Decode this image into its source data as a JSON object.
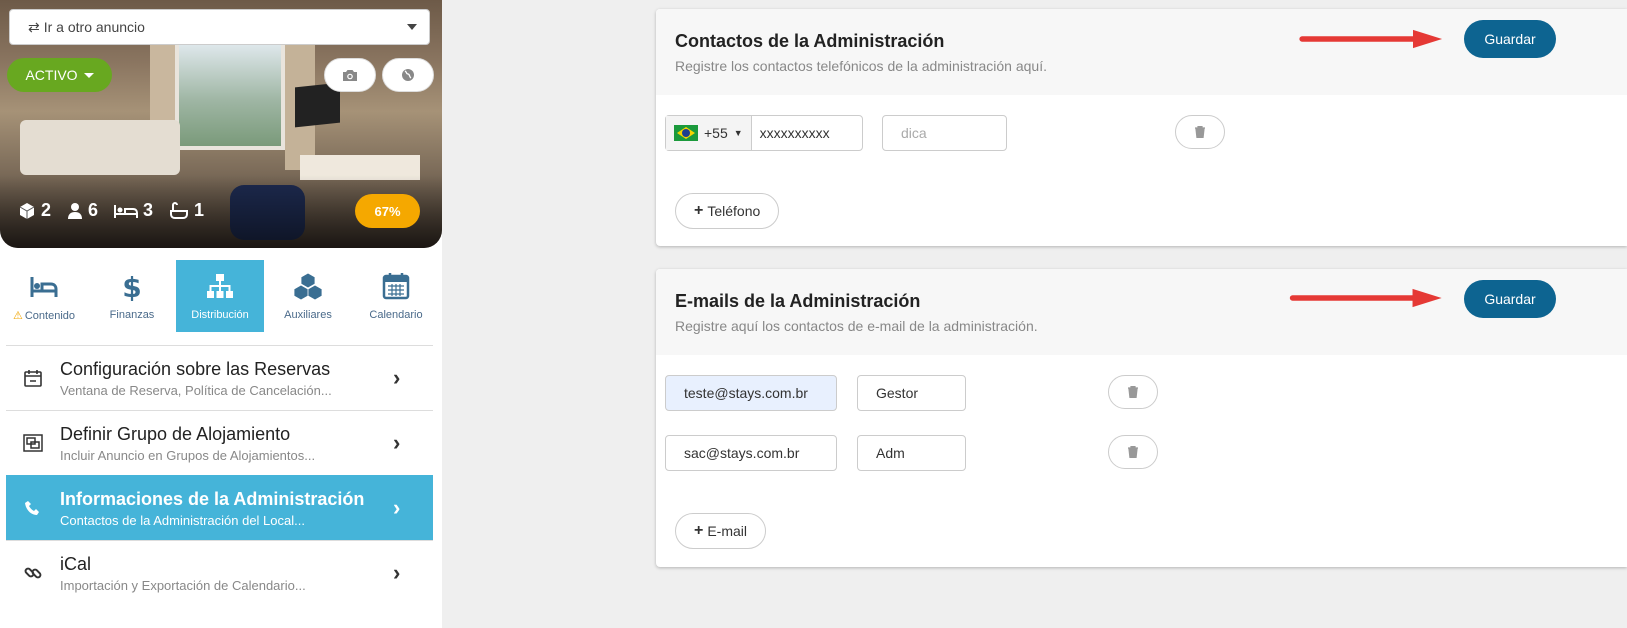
{
  "sidebar": {
    "listing_select": "Ir a otro anuncio",
    "status": "ACTIVO",
    "stats": {
      "rooms": "2",
      "guests": "6",
      "beds": "3",
      "baths": "1"
    },
    "completion": "67%",
    "tabs": [
      {
        "label": "Contenido"
      },
      {
        "label": "Finanzas"
      },
      {
        "label": "Distribución"
      },
      {
        "label": "Auxiliares"
      },
      {
        "label": "Calendario"
      }
    ],
    "menu": [
      {
        "title": "Configuración sobre las Reservas",
        "subtitle": "Ventana de Reserva, Política de Cancelación..."
      },
      {
        "title": "Definir Grupo de Alojamiento",
        "subtitle": "Incluir Anuncio en Grupos de Alojamientos..."
      },
      {
        "title": "Informaciones de la Administración",
        "subtitle": "Contactos de la Administración del Local..."
      },
      {
        "title": "iCal",
        "subtitle": "Importación y Exportación de Calendario..."
      }
    ]
  },
  "phones": {
    "title": "Contactos de la Administración",
    "subtitle": "Registre los contactos telefónicos de la administración aquí.",
    "save_label": "Guardar",
    "country_code": "+55",
    "number": "xxxxxxxxxx",
    "hint_placeholder": "dica",
    "add_label": "Teléfono"
  },
  "emails": {
    "title": "E-mails de la Administración",
    "subtitle": "Registre aquí los contactos de e-mail de la administración.",
    "save_label": "Guardar",
    "rows": [
      {
        "email": "teste@stays.com.br",
        "role": "Gestor"
      },
      {
        "email": "sac@stays.com.br",
        "role": "Adm"
      }
    ],
    "add_label": "E-mail"
  },
  "colors": {
    "accent": "#45b4d9",
    "save": "#0d6491",
    "active": "#68a820",
    "completion": "#f5a800",
    "arrow": "#e53935"
  }
}
